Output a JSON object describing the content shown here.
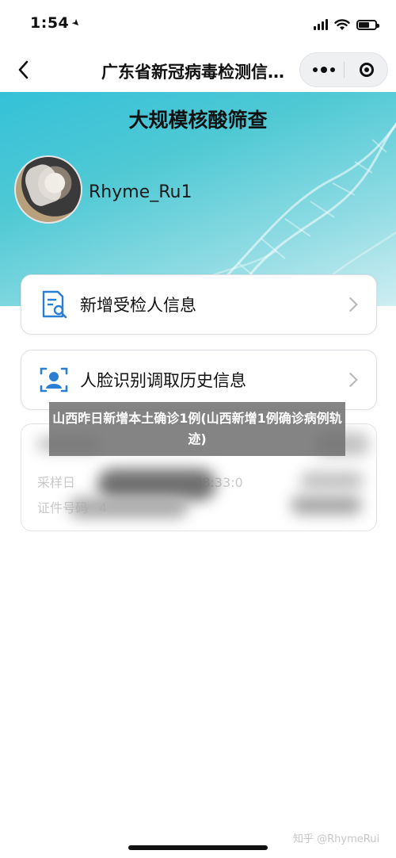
{
  "status_bar": {
    "time": "1:54",
    "battery_level": 0.65
  },
  "nav": {
    "title": "广东省新冠病毒检测信…"
  },
  "hero": {
    "title": "大规模核酸筛查",
    "username": "Rhyme_Ru1"
  },
  "menu": [
    {
      "label": "新增受检人信息",
      "icon": "person-search-document-icon"
    },
    {
      "label": "人脸识别调取历史信息",
      "icon": "face-scan-icon"
    }
  ],
  "record": {
    "line1": "采样日",
    "line1_value": "08:33:0",
    "line2": "证件号码",
    "line2_value": "4"
  },
  "overlay": {
    "caption": "山西昨日新增本土确诊1例(山西新增1例确诊病例轨迹)"
  },
  "watermark": "知乎 @RhymeRui",
  "colors": {
    "hero_start": "#34c1d8",
    "hero_end": "#cfeef2",
    "icon_blue": "#2a7fd4"
  }
}
